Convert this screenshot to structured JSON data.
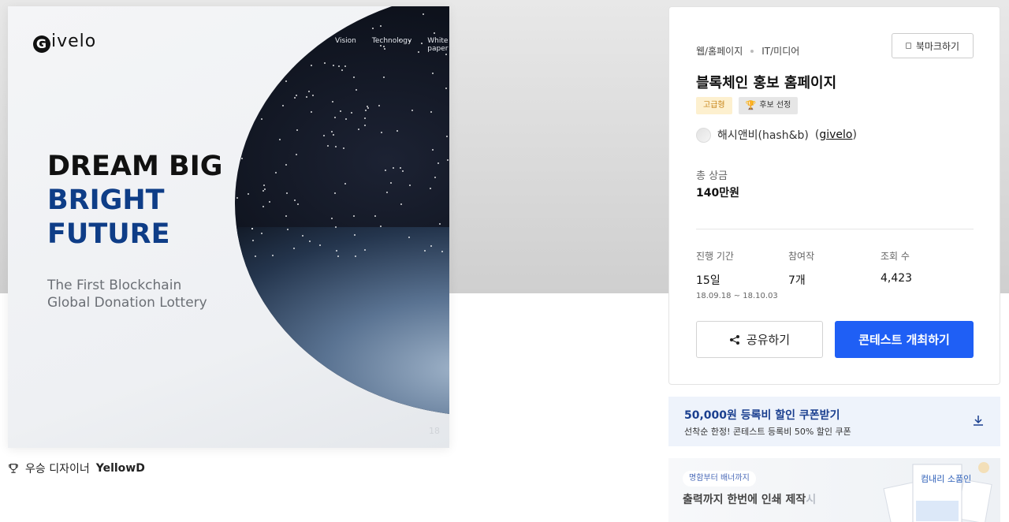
{
  "artwork": {
    "logo": "ivelo",
    "logo_letter": "G",
    "nav": [
      "Vision",
      "Technology",
      "White paper"
    ],
    "headline": [
      "DREAM BIG",
      "BRIGHT",
      "FUTURE"
    ],
    "subtitle": [
      "The First Blockchain",
      "Global Donation Lottery"
    ],
    "page_number": "18"
  },
  "award": {
    "prefix": "우승 디자이너",
    "name": "YellowD"
  },
  "contest": {
    "category_main": "웹/홈페이지",
    "category_sub": "IT/미디어",
    "bookmark_label": "북마크하기",
    "title": "블록체인 홍보 홈페이지",
    "badge_premium": "고급형",
    "badge_candidate": "후보 선정",
    "owner_name": "해시앤비(hash&b)",
    "owner_handle": "givelo",
    "prize_label": "총 상금",
    "prize_value": "140만원",
    "stats": {
      "period_label": "진행 기간",
      "period_value": "15일",
      "period_range": "18.09.18 ~ 18.10.03",
      "entries_label": "참여작",
      "entries_value": "7개",
      "views_label": "조회 수",
      "views_value": "4,423"
    },
    "share_label": "공유하기",
    "host_label": "콘테스트 개최하기"
  },
  "coupon": {
    "title": "50,000원 등록비 할인 쿠폰받기",
    "subtitle": "선착순 한정! 콘테스트 등록비 50% 할인 쿠폰"
  },
  "print_ad": {
    "chip": "명함부터 배너까지",
    "title": "출력까지 한번에 인쇄 제작",
    "title_fade": "시",
    "deco_text": "컴내리 소품인"
  },
  "colors": {
    "primary_button": "#1f5ff5",
    "headline_blue": "#0e3d87",
    "coupon_title": "#1a3f8f",
    "premium_badge_bg": "#fdf0cf"
  }
}
